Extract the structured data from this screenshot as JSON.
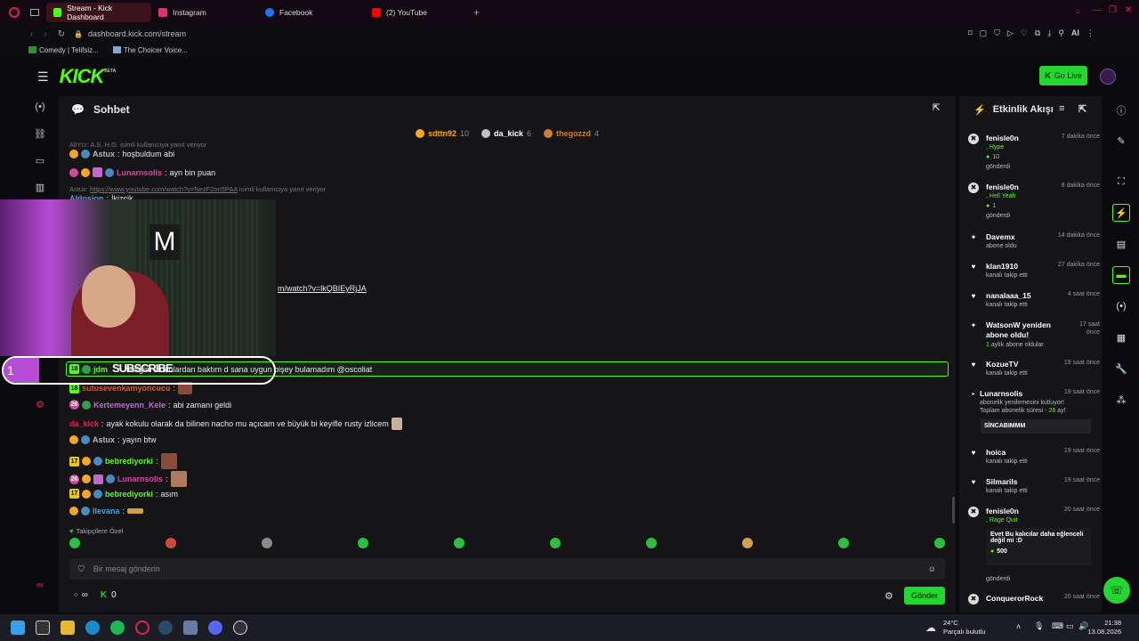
{
  "browser": {
    "tabs": [
      {
        "label": "Stream - Kick Dashboard",
        "active": true,
        "color": "#53fc18"
      },
      {
        "label": "Instagram",
        "active": false,
        "color": "#e1306c"
      },
      {
        "label": "Facebook",
        "active": false,
        "color": "#1877f2"
      },
      {
        "label": "(2) YouTube",
        "active": false,
        "color": "#ff0000"
      }
    ],
    "url": "dashboard.kick.com/stream",
    "bookmarks": [
      "Comedy | Telifsiz...",
      "The Choicer Voice..."
    ],
    "ai_label": "AI"
  },
  "kick": {
    "logo": "KICK",
    "beta": "BETA",
    "go_live": "Go Live"
  },
  "chat": {
    "title": "Sohbet",
    "leaderboard": [
      {
        "rank": "1",
        "name": "sdttn92",
        "count": "10",
        "color": "#f5a623"
      },
      {
        "rank": "2",
        "name": "da_kick",
        "count": "6",
        "color": "#c0c0c0"
      },
      {
        "rank": "3",
        "name": "thegozzd",
        "count": "4",
        "color": "#cd7f32"
      }
    ],
    "reply1": "AliYcr: A.S. H.G. isimli kullanıcıya yanıt veriyor",
    "m1_user": "Astux",
    "m1_text": "hoşbuldum abi",
    "m2_user": "Lunarnsolis",
    "m2_text": "ayn bin puan",
    "reply2_prefix": "Astux: ",
    "reply2_link": "https://www.youtube.com/watch?v=NezF2on5PAA",
    "reply2_suffix": " isimli kullanıcıya yanıt veriyor",
    "m3_user": "Aldosion",
    "m3_text": "İkizcik",
    "link_fragment": "m/watch?v=lkQBIEyRjJA",
    "pinned_badge": "18",
    "pinned_user": "jdm",
    "pinned_text": "lediğim videolardan baktım d  sana uygun bişey bulamadım @oscoliat",
    "m4_badge": "18",
    "m4_user": "sutusevenkamyoncucu",
    "m5_badge": "26",
    "m5_user": "Kertemeyenn_Kele",
    "m5_text": "abi zamanı geldi",
    "m6_user": "da_kick",
    "m6_text": "ayak kokulu olarak da bilinen nacho mu açıcam ve büyük bi keyifle rusty izlicem",
    "m7_user": "Astux",
    "m7_text": "yayın btw",
    "m8_badge": "17",
    "m8_user": "bebrediyorki",
    "m9_badge": "26",
    "m9_user": "Lunarnsolis",
    "m10_badge": "17",
    "m10_user": "bebrediyorki",
    "m10_text": "asım",
    "m11_user": "llevana",
    "followers_only": "Takipçilere Özel",
    "input_placeholder": "Bir mesaj gönderin",
    "infinity": "∞",
    "points": "0",
    "send": "Gönder"
  },
  "activity": {
    "title": "Etkinlik Akışı",
    "items": [
      {
        "name": "fenisle0n",
        "time": "7 dakika önce",
        "line1": ", Hype",
        "line2": "10",
        "line3": "gönderdi",
        "kind": "kick"
      },
      {
        "name": "fenisle0n",
        "time": "8 dakika önce",
        "line1": ", Hell Yeah",
        "line2": "1",
        "line3": "gönderdi",
        "kind": "kick"
      },
      {
        "name": "Davemx",
        "time": "14 dakika önce",
        "line1": "abone oldu",
        "kind": "star"
      },
      {
        "name": "klan1910",
        "time": "27 dakika önce",
        "line1": "kanalı takip etti",
        "kind": "heart"
      },
      {
        "name": "nanalaaa_15",
        "time": "4 saat önce",
        "line1": "kanalı takip etti",
        "kind": "heart"
      },
      {
        "name": "WatsonW yeniden abone oldu!",
        "time": "17 saat önce",
        "line1": "1",
        "line1b": " aylık abone oldular",
        "kind": "star"
      },
      {
        "name": "KozueTV",
        "time": "19 saat önce",
        "line1": "kanalı takip etti",
        "kind": "heart"
      },
      {
        "name": "Lunarnsolis",
        "time": "19 saat önce",
        "line1": "abonelik yenilemesini kutluyor!",
        "line2": "Toplam abonelik süresi - ",
        "line2b": "26",
        "line2c": " ay!",
        "line3": "SİNCABIMMM",
        "kind": "star"
      },
      {
        "name": "hoica",
        "time": "19 saat önce",
        "line1": "kanalı takip etti",
        "kind": "heart"
      },
      {
        "name": "Silmarils",
        "time": "19 saat önce",
        "line1": "kanalı takip etti",
        "kind": "heart"
      },
      {
        "name": "fenisle0n",
        "time": "20 saat önce",
        "line1": ", Rage Quit",
        "line2": "Evet Bu kalıcılar daha eğlenceli değil mi :D",
        "line3": "500",
        "line4": "gönderdi",
        "kind": "kick"
      },
      {
        "name": "ConquerorRock",
        "time": "20 saat önce",
        "kind": "kick"
      }
    ]
  },
  "overlay": {
    "subscribe": "SUBSCRIBE",
    "stripe_digit": "1"
  },
  "taskbar": {
    "temp": "24°C",
    "weather": "Parçalı bulutlu",
    "time": "21:38",
    "date": "13.08.2026"
  }
}
